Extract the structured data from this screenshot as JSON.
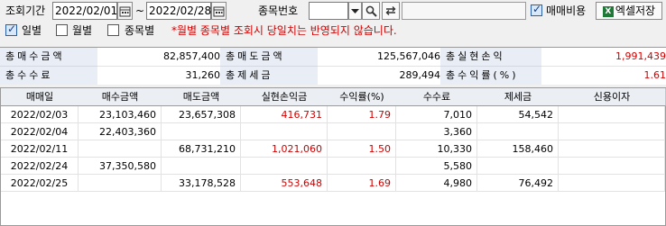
{
  "filter": {
    "period_label": "조회기간",
    "date_from": "2022/02/01",
    "date_to": "2022/02/28",
    "tilde": "~",
    "code_label": "종목번호",
    "code_value": "",
    "fee_label": "매매비용",
    "fee_checked": true,
    "excel_label": "엑셀저장",
    "daily_label": "일별",
    "monthly_label": "월별",
    "stock_label": "종목별",
    "note": "*월별 종목별 조회시 당일치는 반영되지 않습니다."
  },
  "summary": {
    "sell_amount_label": "총매수금액",
    "sell_amount_value": "82,857,400",
    "buy_amount_label": "총매도금액",
    "buy_amount_value": "125,567,046",
    "realized_label": "총실현손익",
    "realized_value": "1,991,439",
    "fee_label": "총수수료",
    "fee_value": "31,260",
    "tax_label": "총제세금",
    "tax_value": "289,494",
    "rate_label": "총수익률(%)",
    "rate_value": "1.61"
  },
  "table": {
    "columns": [
      "매매일",
      "매수금액",
      "매도금액",
      "실현손익금",
      "수익률(%)",
      "수수료",
      "제세금",
      "신용이자"
    ],
    "rows": [
      [
        "2022/02/03",
        "23,103,460",
        "23,657,308",
        "416,731",
        "1.79",
        "7,010",
        "54,542",
        ""
      ],
      [
        "2022/02/04",
        "22,403,360",
        "",
        "",
        "",
        "3,360",
        "",
        ""
      ],
      [
        "2022/02/11",
        "",
        "68,731,210",
        "1,021,060",
        "1.50",
        "10,330",
        "158,460",
        ""
      ],
      [
        "2022/02/24",
        "37,350,580",
        "",
        "",
        "",
        "5,580",
        "",
        ""
      ],
      [
        "2022/02/25",
        "",
        "33,178,528",
        "553,648",
        "1.69",
        "4,980",
        "76,492",
        ""
      ]
    ]
  },
  "colors": {
    "positive": "#d00000"
  }
}
